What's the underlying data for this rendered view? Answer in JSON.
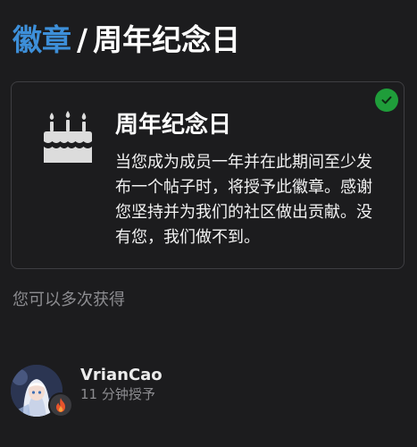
{
  "breadcrumb": {
    "parent": "徽章",
    "separator": "/",
    "current": "周年纪念日"
  },
  "badge": {
    "icon": "birthday-cake-icon",
    "title": "周年纪念日",
    "description": "当您成为成员一年并在此期间至少发布一个帖子时，将授予此徽章。感谢您坚持并为我们的社区做出贡献。没有您，我们做不到。",
    "earned": true,
    "earned_icon": "check-icon"
  },
  "repeat_note": "您可以多次获得",
  "grantee": {
    "username": "VrianCao",
    "granted_time": "11 分钟授予",
    "badge_icon": "flame-icon"
  },
  "colors": {
    "background": "#1c1c1e",
    "link": "#3d8fd9",
    "success": "#1f9d3a",
    "muted_text": "#8c8c90",
    "flame": "#e8542c"
  }
}
